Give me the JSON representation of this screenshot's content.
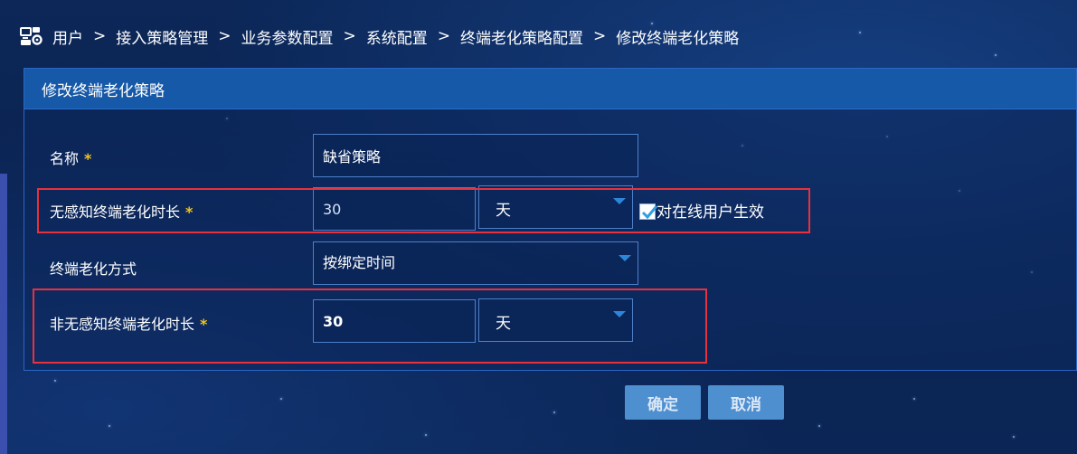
{
  "breadcrumb": {
    "icon": "network-settings-icon",
    "items": [
      "用户",
      "接入策略管理",
      "业务参数配置",
      "系统配置",
      "终端老化策略配置",
      "修改终端老化策略"
    ],
    "separator": ">"
  },
  "panel": {
    "title": "修改终端老化策略"
  },
  "form": {
    "name": {
      "label": "名称",
      "required": "*",
      "value": "缺省策略"
    },
    "silent_aging": {
      "label": "无感知终端老化时长",
      "required": "*",
      "value": "30",
      "unit": "天",
      "checkbox_label": "对在线用户生效",
      "checkbox_checked": true
    },
    "aging_mode": {
      "label": "终端老化方式",
      "value": "按绑定时间"
    },
    "non_silent_aging": {
      "label": "非无感知终端老化时长",
      "required": "*",
      "value": "30",
      "unit": "天"
    }
  },
  "buttons": {
    "confirm": "确定",
    "cancel": "取消"
  },
  "colors": {
    "background": "#0b2656",
    "panel_header": "#1659a8",
    "button": "#4e8fd0",
    "required_mark": "#f0c419",
    "highlight_border": "#e8313a",
    "caret": "#2e86d8"
  }
}
